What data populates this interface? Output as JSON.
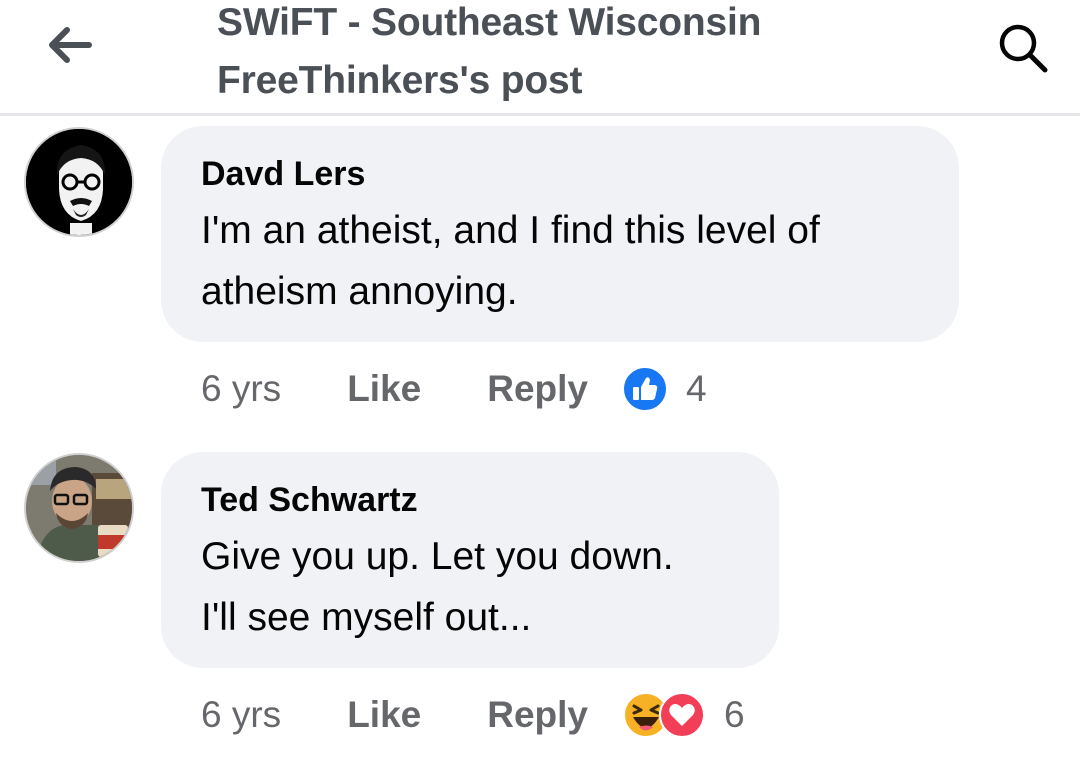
{
  "header": {
    "title_line1": "SWiFT - Southeast Wisconsin",
    "title_line2": "FreeThinkers's post"
  },
  "comments": [
    {
      "author": "Davd Lers",
      "text_line1": "I'm an atheist, and I find this level of",
      "text_line2": "atheism annoying.",
      "time": "6 yrs",
      "like_label": "Like",
      "reply_label": "Reply",
      "reaction_count": "4",
      "reactions": [
        "like-reaction-icon"
      ]
    },
    {
      "author": "Ted Schwartz",
      "text_line1": "Give you up. Let you down.",
      "text_line2": "I'll see myself out...",
      "time": "6 yrs",
      "like_label": "Like",
      "reply_label": "Reply",
      "reaction_count": "6",
      "reactions": [
        "haha-reaction-icon",
        "love-reaction-icon"
      ]
    }
  ],
  "colors": {
    "bubble": "#f0f2f5",
    "meta_text": "#65676b",
    "like_blue": "#1877f2",
    "love_red": "#f33e58",
    "haha_yellow": "#f7b125"
  }
}
